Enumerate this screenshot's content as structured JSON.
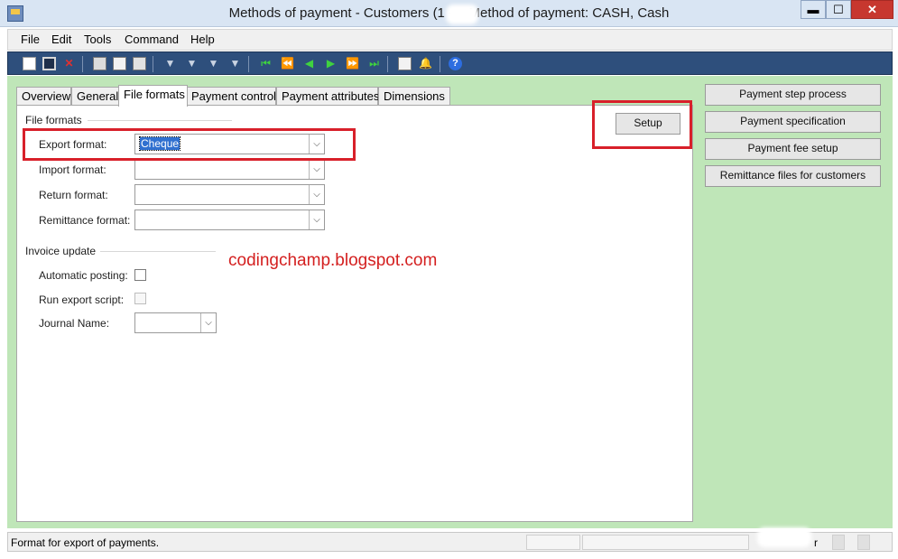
{
  "window": {
    "title": "Methods of payment - Customers (1 -  ‎ - Method of payment: CASH, Cash",
    "min_label": "▬",
    "max_label": "☐",
    "close_label": "✕"
  },
  "menu": [
    "File",
    "Edit",
    "Tools",
    "Command",
    "Help"
  ],
  "toolbar": {
    "icons": [
      "new-icon",
      "save-icon",
      "delete-icon",
      "print-icon",
      "print-preview-icon",
      "export-icon",
      "filter-by-selection-icon",
      "advanced-filter-icon",
      "filter-by-grid-icon",
      "remove-filter-icon",
      "first-record-icon",
      "previous-page-icon",
      "previous-record-icon",
      "next-record-icon",
      "next-page-icon",
      "last-record-icon",
      "attachments-icon",
      "alert-icon",
      "help-icon"
    ]
  },
  "tabs": [
    "Overview",
    "General",
    "File formats",
    "Payment control",
    "Payment attributes",
    "Dimensions"
  ],
  "active_tab": "File formats",
  "file_formats": {
    "group_label": "File formats",
    "fields": [
      {
        "label": "Export format:",
        "value": "Cheque"
      },
      {
        "label": "Import format:",
        "value": ""
      },
      {
        "label": "Return format:",
        "value": ""
      },
      {
        "label": "Remittance format:",
        "value": ""
      }
    ]
  },
  "invoice_update": {
    "group_label": "Invoice update",
    "automatic_posting_label": "Automatic posting:",
    "run_export_script_label": "Run export script:",
    "journal_name_label": "Journal Name:",
    "journal_name_value": ""
  },
  "setup_button": "Setup",
  "watermark": "codingchamp.blogspot.com",
  "side_buttons": [
    "Payment step process",
    "Payment specification",
    "Payment fee setup",
    "Remittance files for customers"
  ],
  "status": {
    "text": "Format for export of payments.",
    "right_text": "r"
  },
  "colors": {
    "form_background": "#bfe6b8",
    "toolbar": "#2e4f7c",
    "highlight_box": "#d8202a",
    "watermark": "#d42020"
  }
}
